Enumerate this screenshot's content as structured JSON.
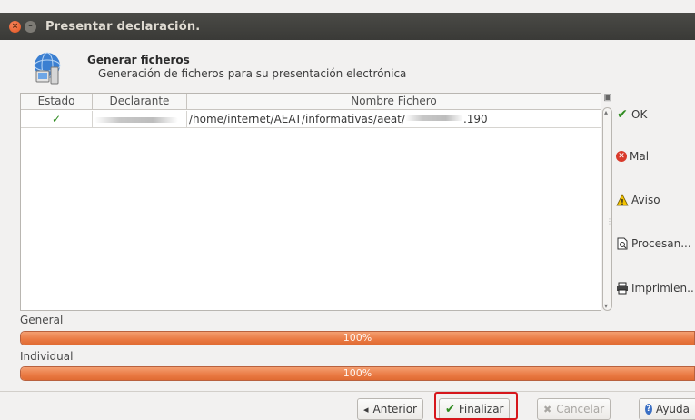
{
  "window": {
    "title": "Presentar declaración."
  },
  "header": {
    "title": "Generar ficheros",
    "subtitle": "Generación de ficheros para su presentación electrónica"
  },
  "table": {
    "columns": [
      "Estado",
      "Declarante",
      "Nombre Fichero"
    ],
    "rows": [
      {
        "estado": "✓",
        "declarante": "",
        "fichero_prefix": "/home/internet/AEAT/informativas/aeat/",
        "fichero_suffix": ".190"
      }
    ]
  },
  "legend": {
    "ok": "OK",
    "mal": "Mal",
    "aviso": "Aviso",
    "procesando": "Procesan...",
    "imprimiendo": "Imprimien..."
  },
  "progress": {
    "general_label": "General",
    "general_value": 100,
    "general_text": "100%",
    "individual_label": "Individual",
    "individual_value": 100,
    "individual_text": "100%"
  },
  "buttons": {
    "anterior": "Anterior",
    "finalizar": "Finalizar",
    "cancelar": "Cancelar",
    "ayuda": "Ayuda"
  },
  "colors": {
    "progress_fill": "#ea7a43",
    "highlight": "#d6161b",
    "ok_green": "#2e8b1f"
  }
}
